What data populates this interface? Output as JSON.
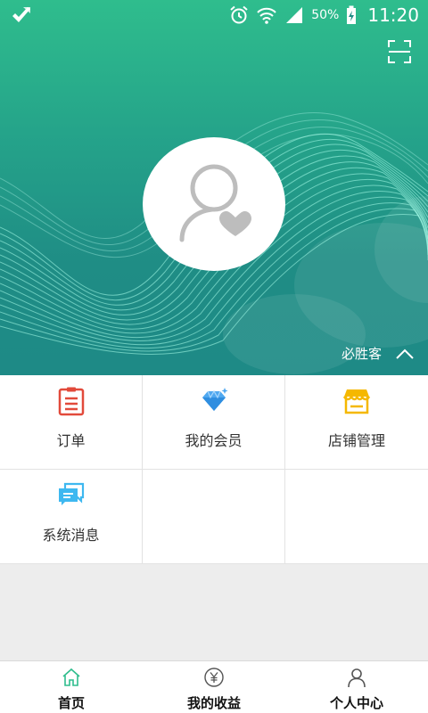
{
  "status_bar": {
    "battery_percent": "50%",
    "time": "11:20",
    "icons": [
      "app-notification-icon",
      "alarm-icon",
      "wifi-icon",
      "signal-icon",
      "battery-charging-icon"
    ]
  },
  "header": {
    "scan_icon": "scan-icon",
    "avatar_icon": "user-heart-icon",
    "brand_name": "必胜客",
    "collapse_icon": "chevron-up-icon",
    "gradient_colors": [
      "#2fbd8d",
      "#1e8a86"
    ]
  },
  "menu": {
    "items": [
      {
        "label": "订单",
        "icon": "order-list-icon",
        "color": "#e24a3b"
      },
      {
        "label": "我的会员",
        "icon": "diamond-icon",
        "color": "#4fa8f0"
      },
      {
        "label": "店铺管理",
        "icon": "store-icon",
        "color": "#f5b800"
      },
      {
        "label": "系统消息",
        "icon": "chat-bubbles-icon",
        "color": "#3eb8f0"
      }
    ]
  },
  "tabbar": {
    "tabs": [
      {
        "label": "首页",
        "icon": "home-icon",
        "active": true
      },
      {
        "label": "我的收益",
        "icon": "yuan-coin-icon",
        "active": false
      },
      {
        "label": "个人中心",
        "icon": "person-icon",
        "active": false
      }
    ]
  },
  "colors": {
    "accent": "#2fbd8d",
    "active_tab_icon": "#2fbd8d",
    "inactive_tab_icon": "#555555"
  }
}
